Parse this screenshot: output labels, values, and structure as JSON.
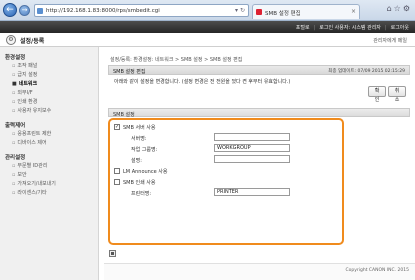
{
  "browser": {
    "url": "http://192.168.1.83:8000/rps/smbedit.cgi",
    "tab_title": "SMB 설정 편집",
    "tab_close": "×",
    "nav_back": "←",
    "nav_forward": "→",
    "address_icons": "▾ ↻",
    "tools": "⌂☆⚙"
  },
  "topbar": {
    "portal": "포털로",
    "login_user": "로그인 사용자: 시스템 관리자",
    "logout": "로그아웃"
  },
  "header": {
    "title": "설정/등록",
    "right_link": "관리자에게 메일"
  },
  "sidebar": {
    "sections": [
      {
        "title": "환경설정",
        "items": [
          "조작 패널",
          "급지 설정",
          "네트워크",
          "외부I/F",
          "인쇄 환경",
          "사용자 유지보수"
        ]
      },
      {
        "title": "출력제어",
        "items": [
          "응용프린트 제한",
          "디바이스 제어"
        ]
      },
      {
        "title": "관리설정",
        "items": [
          "부문별 ID관리",
          "보안",
          "가져오기/내보내기",
          "라이센스/기타"
        ]
      }
    ],
    "active": "네트워크"
  },
  "main": {
    "breadcrumb": "설정/등록: 환경설정: 네트워크 > SMB 설정 > SMB 설정 편집",
    "panel_title": "SMB 설정 편집",
    "last_update": "최종 업데이트: 07/09 2015 02:15:29",
    "notice": "아래와 같이 설정을 변경합니다. (설정 변경은 전 전원을 껐다 켠 후부터 유효합니다.)",
    "ok_label": "확인",
    "cancel_label": "취소",
    "section_title": "SMB 설정",
    "fields": {
      "use_smb_server": {
        "label": "SMB 서버 사용",
        "checked": true
      },
      "server_name": {
        "label": "서버명:",
        "value": ""
      },
      "workgroup": {
        "label": "작업 그룹명:",
        "value": "WORKGROUP"
      },
      "comment": {
        "label": "설명:",
        "value": ""
      },
      "lm_announce": {
        "label": "LM Announce 사용",
        "checked": false
      },
      "use_smb_print": {
        "label": "SMB 인쇄 사용",
        "checked": false
      },
      "printer_name": {
        "label": "프린터명:",
        "value": "PRINTER"
      }
    },
    "check_mark": "✓"
  },
  "footer": {
    "copyright": "Copyright CANON INC. 2015"
  }
}
